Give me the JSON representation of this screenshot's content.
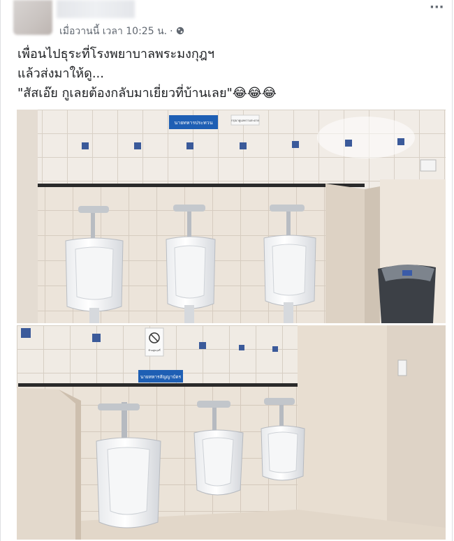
{
  "post": {
    "author_name": "",
    "timestamp": "เมื่อวานนี้ เวลา 10:25 น.",
    "separator": "·",
    "privacy_icon": "globe-icon",
    "more_icon": "more-options-icon",
    "text_lines": [
      "เพื่อนไปธุระที่โรงพยาบาลพระมงกุฎฯ",
      "แล้วส่งมาให้ดู...",
      "\"สัสเอ๊ย กูเลยต้องกลับมาเยี่ยวที่บ้านเลย\"😂😂😂"
    ]
  },
  "photos": [
    {
      "sign_main": "นายทหารประทวน",
      "sign_small": "กรุณาดูแลความสะอาด",
      "urinal_count": 3
    },
    {
      "sign_main": "นายทหารสัญญาบัตร",
      "sign_no_smoking": "ห้ามสูบบุหรี่",
      "urinal_count": 3
    }
  ],
  "colors": {
    "text": "#1c1e21",
    "meta": "#606770",
    "border": "#dddfe2",
    "sign_blue": "#1e5fb4",
    "tile": "#efe9e2"
  }
}
